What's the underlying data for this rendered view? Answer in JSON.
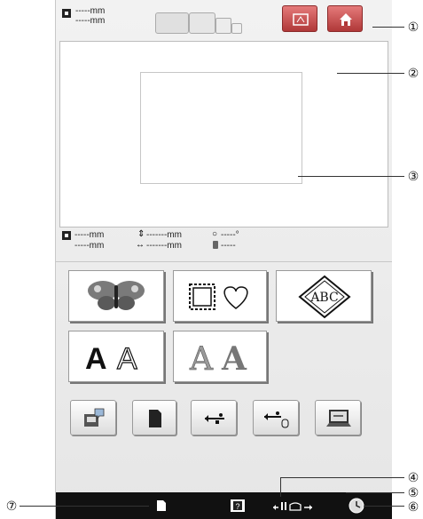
{
  "top": {
    "size_line1": "-----mm",
    "size_line2": "-----mm",
    "icons": [
      "size-icon",
      "hoop-size-icon",
      "embroidery-icon",
      "home-icon"
    ]
  },
  "info": {
    "size_line1": "-----mm",
    "size_line2": "-----mm",
    "vertical_offset": "-------mm",
    "horizontal_offset": "-------mm",
    "angle": "-----°",
    "thread": "-----"
  },
  "categories": {
    "row1": [
      "embroidery-patterns",
      "frame-patterns",
      "monogram"
    ],
    "row2": [
      "alphabet-fonts",
      "decorative-alphabet"
    ]
  },
  "sources": [
    "machine-memory",
    "sd-card",
    "usb-media",
    "usb-mouse",
    "computer-usb"
  ],
  "callouts": {
    "c1": "①",
    "c2": "②",
    "c3": "③",
    "c4": "④",
    "c5": "⑤",
    "c6": "⑥",
    "c7": "⑦"
  },
  "bottom_icons": [
    "page-icon",
    "help-icon",
    "needle-position-icon",
    "clock-icon"
  ]
}
